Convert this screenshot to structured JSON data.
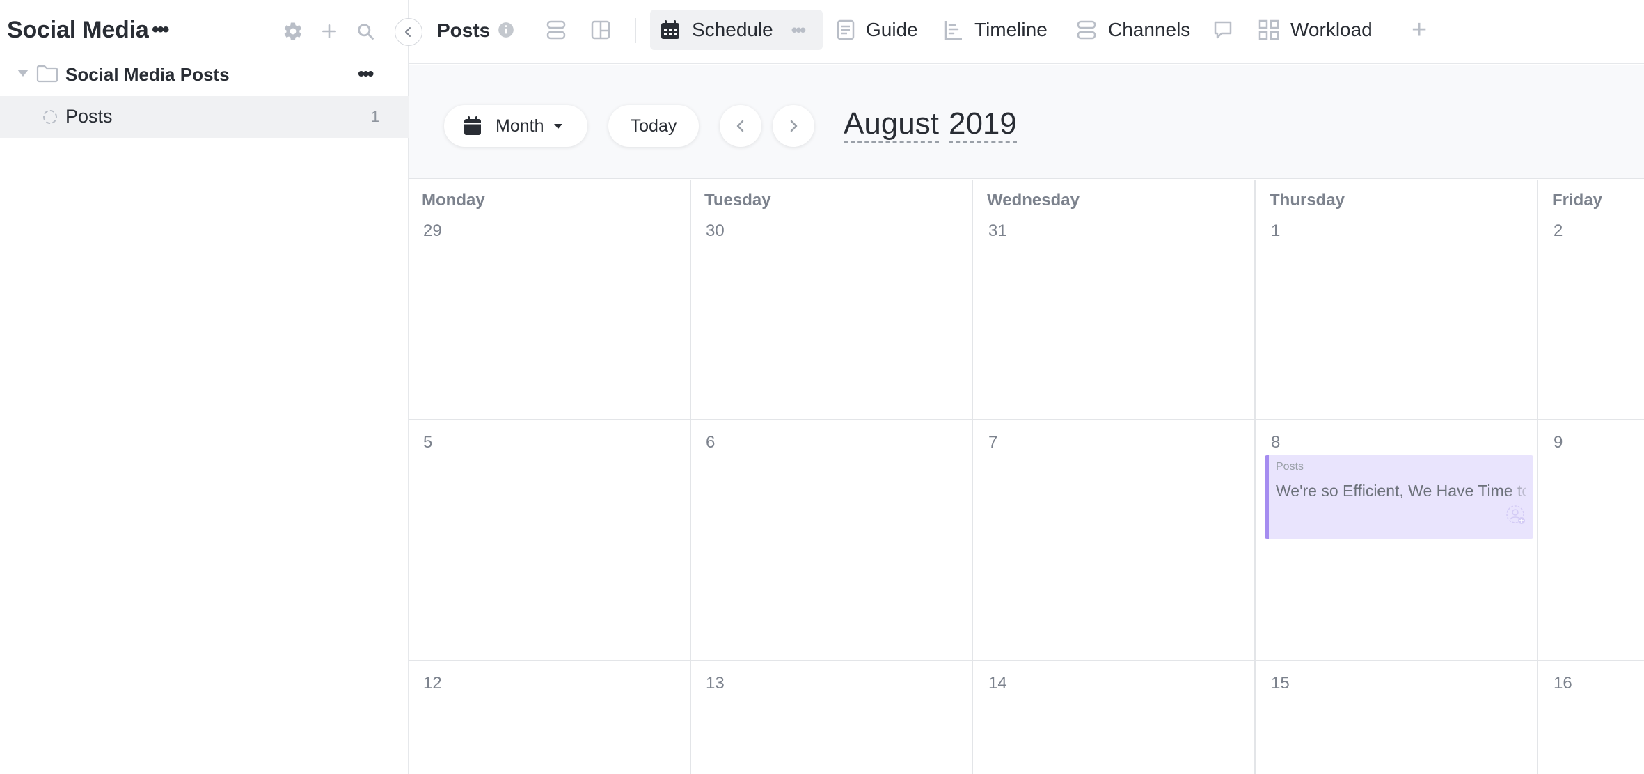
{
  "sidebar": {
    "title": "Social Media",
    "title_menu": "•••",
    "folder": {
      "label": "Social Media Posts",
      "menu": "•••"
    },
    "list": {
      "label": "Posts",
      "count": "1"
    }
  },
  "nav": {
    "list_title": "Posts",
    "tabs": [
      {
        "label": "Schedule",
        "icon": "calendar-icon",
        "active": true,
        "menu": "•••"
      },
      {
        "label": "Guide",
        "icon": "document-icon"
      },
      {
        "label": "Timeline",
        "icon": "timeline-icon"
      },
      {
        "label": "Channels",
        "icon": "channels-icon"
      },
      {
        "label": "",
        "icon": "chat-icon"
      },
      {
        "label": "Workload",
        "icon": "grid-icon"
      }
    ],
    "add": "+"
  },
  "toolbar": {
    "view_mode": "Month",
    "today": "Today",
    "month": "August",
    "year": "2019"
  },
  "calendar": {
    "weekdays": [
      "Monday",
      "Tuesday",
      "Wednesday",
      "Thursday",
      "Friday"
    ],
    "weeks": [
      [
        "29",
        "30",
        "31",
        "1",
        "2"
      ],
      [
        "5",
        "6",
        "7",
        "8",
        "9"
      ],
      [
        "12",
        "13",
        "14",
        "15",
        "16"
      ]
    ],
    "events": [
      {
        "list": "Posts",
        "title": "We're so Efficient, We Have Time to Spare",
        "day": "8"
      }
    ]
  },
  "colors": {
    "event_bg": "#e9e4fd",
    "event_border": "#a58cf0",
    "active_tab_bg": "#f0f1f3"
  }
}
